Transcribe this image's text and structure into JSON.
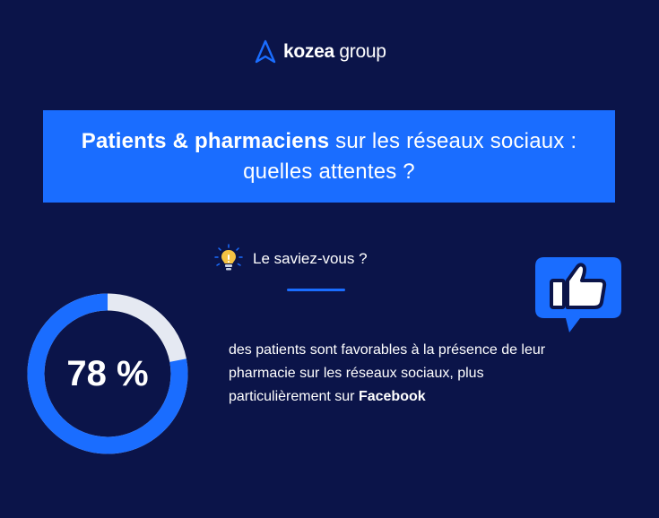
{
  "brand": {
    "name_bold": "kozea",
    "name_regular": " group",
    "accent_color": "#1a6dff",
    "background_color": "#0b1449"
  },
  "title": {
    "bold": "Patients & pharmaciens",
    "rest": " sur les réseaux sociaux : quelles attentes ?"
  },
  "didyouknow": {
    "label": "Le saviez-vous ?",
    "icon": "lightbulb-icon"
  },
  "stat": {
    "percent_label": "78 %",
    "value": 78,
    "text_before": "des patients sont favorables à la présence de leur pharmacie sur les réseaux sociaux, plus particulièrement sur ",
    "text_bold": "Facebook",
    "ring_fill_color": "#1a6dff",
    "ring_track_color": "#e5e9f2"
  },
  "decoration": {
    "icon": "thumbs-up-icon"
  }
}
